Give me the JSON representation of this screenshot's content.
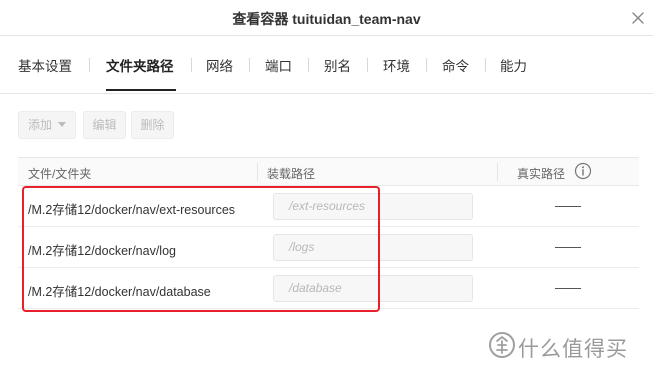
{
  "dialog": {
    "title": "查看容器 tuituidan_team-nav"
  },
  "tabs": [
    {
      "label": "基本设置",
      "active": false
    },
    {
      "label": "文件夹路径",
      "active": true
    },
    {
      "label": "网络",
      "active": false
    },
    {
      "label": "端口",
      "active": false
    },
    {
      "label": "别名",
      "active": false
    },
    {
      "label": "环境",
      "active": false
    },
    {
      "label": "命令",
      "active": false
    },
    {
      "label": "能力",
      "active": false
    }
  ],
  "toolbar": {
    "add_label": "添加",
    "edit_label": "编辑",
    "delete_label": "删除"
  },
  "table": {
    "headers": {
      "file_folder": "文件/文件夹",
      "mount_path": "装载路径",
      "real_path": "真实路径"
    },
    "rows": [
      {
        "path": "/M.2存储12/docker/nav/ext-resources",
        "mount": "/ext-resources",
        "real": "——"
      },
      {
        "path": "/M.2存储12/docker/nav/log",
        "mount": "/logs",
        "real": "——"
      },
      {
        "path": "/M.2存储12/docker/nav/database",
        "mount": "/database",
        "real": "——"
      }
    ]
  },
  "highlight_color": "#e8202a",
  "icons": {
    "close": "close-icon",
    "info": "info-icon",
    "dropdown": "caret-down-icon"
  },
  "watermark": {
    "text": "什么值得买"
  }
}
